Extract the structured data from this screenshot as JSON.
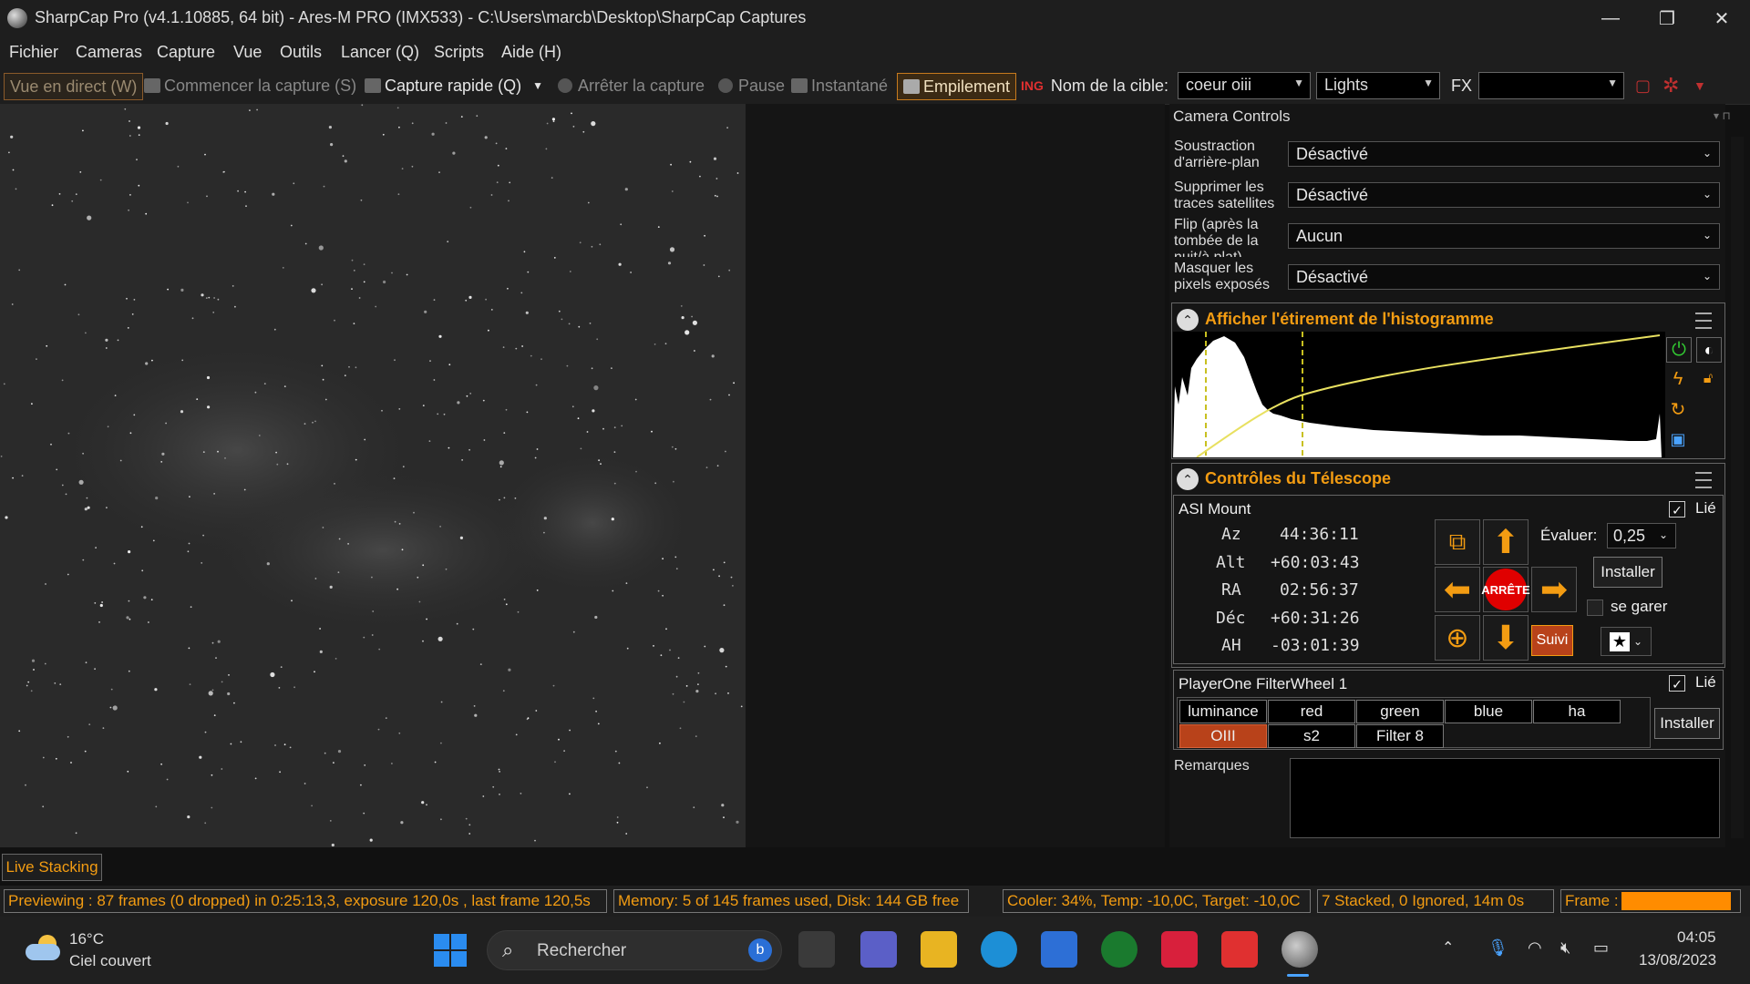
{
  "window": {
    "title": "SharpCap Pro (v4.1.10885, 64 bit) - Ares-M PRO (IMX533) - C:\\Users\\marcb\\Desktop\\SharpCap Captures",
    "minimize": "—",
    "maximize": "❐",
    "close": "✕"
  },
  "menu": {
    "items": [
      "Fichier",
      "Cameras",
      "Capture",
      "Vue",
      "Outils",
      "Lancer (Q)",
      "Scripts",
      "Aide (H)"
    ]
  },
  "toolbar": {
    "live_view": "Vue en direct (W)",
    "start_capture": "Commencer la capture (S)",
    "quick_capture": "Capture rapide (Q)",
    "stop_capture": "Arrêter la capture",
    "pause": "Pause",
    "snapshot": "Instantané",
    "stacking": "Empilement",
    "target_label": "Nom de la cible:",
    "target_value": "coeur oiii",
    "frame_type": "Lights",
    "fx_label": "FX",
    "fx_value": ""
  },
  "panel": {
    "title": "Camera Controls",
    "settings": [
      {
        "label": "Soustraction d'arrière-plan",
        "value": "Désactivé"
      },
      {
        "label": "Supprimer les traces satellites",
        "value": "Désactivé"
      },
      {
        "label": "Flip (après la tombée de la nuit/à plat)",
        "value": "Aucun"
      },
      {
        "label": "Masquer les pixels exposés",
        "value": "Désactivé"
      }
    ],
    "histogram_title": "Afficher l'étirement de l'histogramme",
    "telescope_title": "Contrôles du Télescope",
    "mount": {
      "name": "ASI Mount",
      "linked_label": "Lié",
      "coords": [
        {
          "label": "Az",
          "value": "44:36:11"
        },
        {
          "label": "Alt",
          "value": "+60:03:43"
        },
        {
          "label": "RA",
          "value": "02:56:37"
        },
        {
          "label": "Déc",
          "value": "+60:31:26"
        },
        {
          "label": "AH",
          "value": "-03:01:39"
        }
      ],
      "stop_label": "ARRÊTE",
      "rate_label": "Évaluer:",
      "rate_value": "0,25",
      "install_label": "Installer",
      "park_label": "se garer",
      "track_label": "Suivi"
    },
    "filterwheel": {
      "name": "PlayerOne FilterWheel 1",
      "linked_label": "Lié",
      "filters_row1": [
        "luminance",
        "red",
        "green",
        "blue",
        "ha"
      ],
      "filters_row2": [
        "OIII",
        "s2",
        "Filter 8"
      ],
      "selected": "OIII",
      "install_label": "Installer"
    },
    "remarks_label": "Remarques"
  },
  "live_stacking_tab": "Live Stacking",
  "status": {
    "preview": "Previewing : 87 frames (0 dropped) in 0:25:13,3, exposure 120,0s , last frame 120,5s",
    "memory": "Memory: 5 of 145 frames used, Disk: 144 GB free",
    "cooler": "Cooler: 34%, Temp: -10,0C, Target: -10,0C",
    "stacked": "7 Stacked, 0 Ignored, 14m 0s",
    "frame_label": "Frame :",
    "frame_progress": 1.0
  },
  "taskbar": {
    "weather_temp": "16°C",
    "weather_desc": "Ciel couvert",
    "search_placeholder": "Rechercher",
    "time": "04:05",
    "date": "13/08/2023"
  },
  "colors": {
    "accent": "#f39c12",
    "selected_filter": "#b8421a",
    "stop_red": "#e00000",
    "histogram_curve": "#e8e060"
  }
}
